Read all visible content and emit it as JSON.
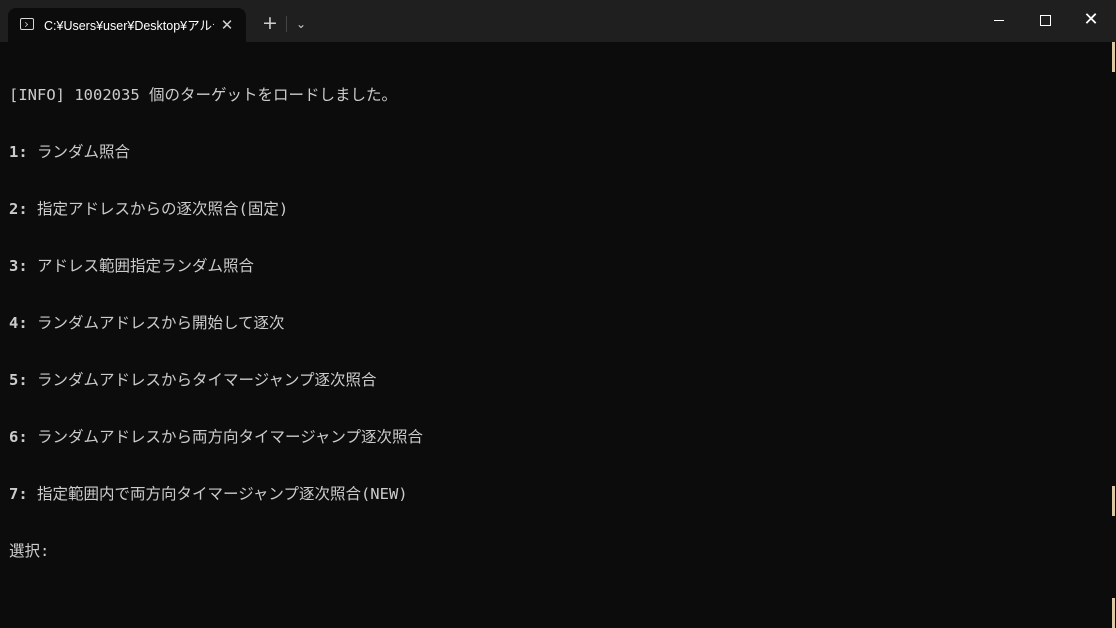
{
  "window": {
    "tab_title": "C:¥Users¥user¥Desktop¥アルテ",
    "tab_close": "✕",
    "new_tab": "+",
    "dropdown": "⌄",
    "close": "✕",
    "icons": [
      "terminal-icon",
      "close-icon",
      "plus-icon",
      "chevron-down-icon",
      "minimize-icon",
      "maximize-icon",
      "close-icon"
    ]
  },
  "console": {
    "info": "[INFO] 1002035 個のターゲットをロードしました。",
    "options": [
      {
        "num": "1:",
        "text": " ランダム照合"
      },
      {
        "num": "2:",
        "text": " 指定アドレスからの逐次照合(固定)"
      },
      {
        "num": "3:",
        "text": " アドレス範囲指定ランダム照合"
      },
      {
        "num": "4:",
        "text": " ランダムアドレスから開始して逐次"
      },
      {
        "num": "5:",
        "text": " ランダムアドレスからタイマージャンプ逐次照合"
      },
      {
        "num": "6:",
        "text": " ランダムアドレスから両方向タイマージャンプ逐次照合"
      },
      {
        "num": "7:",
        "text": " 指定範囲内で両方向タイマージャンプ逐次照合(NEW)"
      }
    ],
    "prompt": "選択: "
  },
  "colors": {
    "background": "#0c0c0c",
    "titlebar": "#1f1f1f",
    "text": "#cccccc"
  }
}
